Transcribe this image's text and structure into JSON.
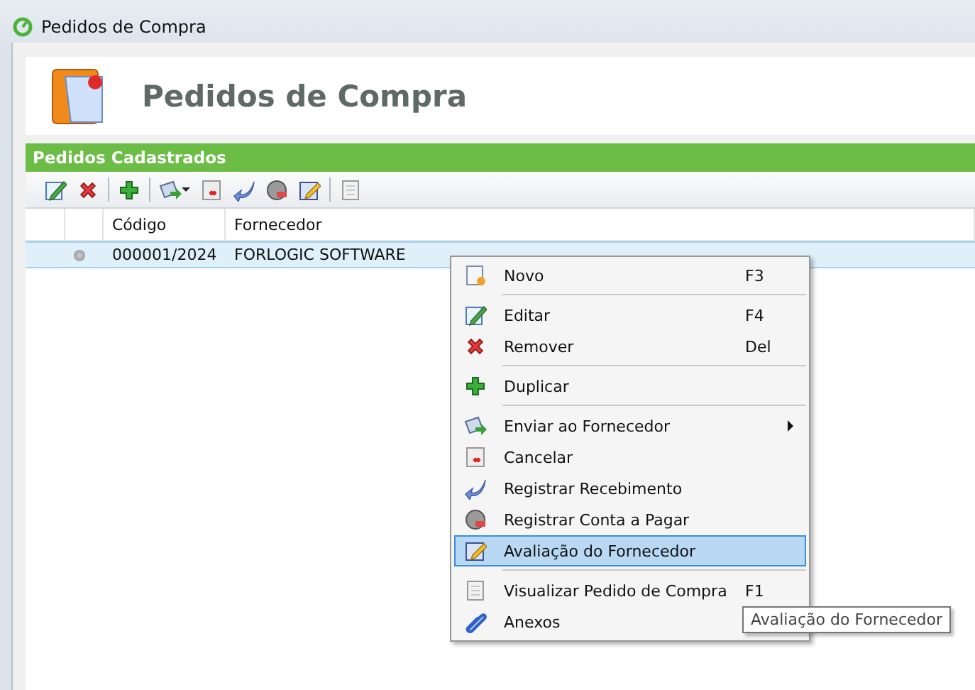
{
  "window": {
    "title": "Pedidos de Compra"
  },
  "header": {
    "title": "Pedidos de Compra"
  },
  "panel": {
    "title": "Pedidos Cadastrados"
  },
  "table": {
    "columns": [
      "Código",
      "Fornecedor"
    ],
    "rows": [
      {
        "codigo": "000001/2024",
        "fornecedor": "FORLOGIC SOFTWARE",
        "selected": true
      }
    ]
  },
  "context_menu": [
    {
      "kind": "item",
      "label": "Novo",
      "shortcut": "F3",
      "selected": false
    },
    {
      "kind": "separator"
    },
    {
      "kind": "item",
      "label": "Editar",
      "shortcut": "F4",
      "selected": false
    },
    {
      "kind": "item",
      "label": "Remover",
      "shortcut": "Del",
      "selected": false
    },
    {
      "kind": "separator"
    },
    {
      "kind": "item",
      "label": "Duplicar",
      "selected": false
    },
    {
      "kind": "separator"
    },
    {
      "kind": "item",
      "label": "Enviar ao Fornecedor",
      "has_submenu": true,
      "selected": false
    },
    {
      "kind": "item",
      "label": "Cancelar",
      "selected": false
    },
    {
      "kind": "item",
      "label": "Registrar Recebimento",
      "selected": false
    },
    {
      "kind": "item",
      "label": "Registrar Conta a Pagar",
      "selected": false
    },
    {
      "kind": "item",
      "label": "Avaliação do Fornecedor",
      "selected": true
    },
    {
      "kind": "separator"
    },
    {
      "kind": "item",
      "label": "Visualizar Pedido de Compra",
      "shortcut": "F1",
      "selected": false
    },
    {
      "kind": "item",
      "label": "Anexos",
      "selected": false
    }
  ],
  "tooltip": {
    "text": "Avaliação do Fornecedor"
  }
}
